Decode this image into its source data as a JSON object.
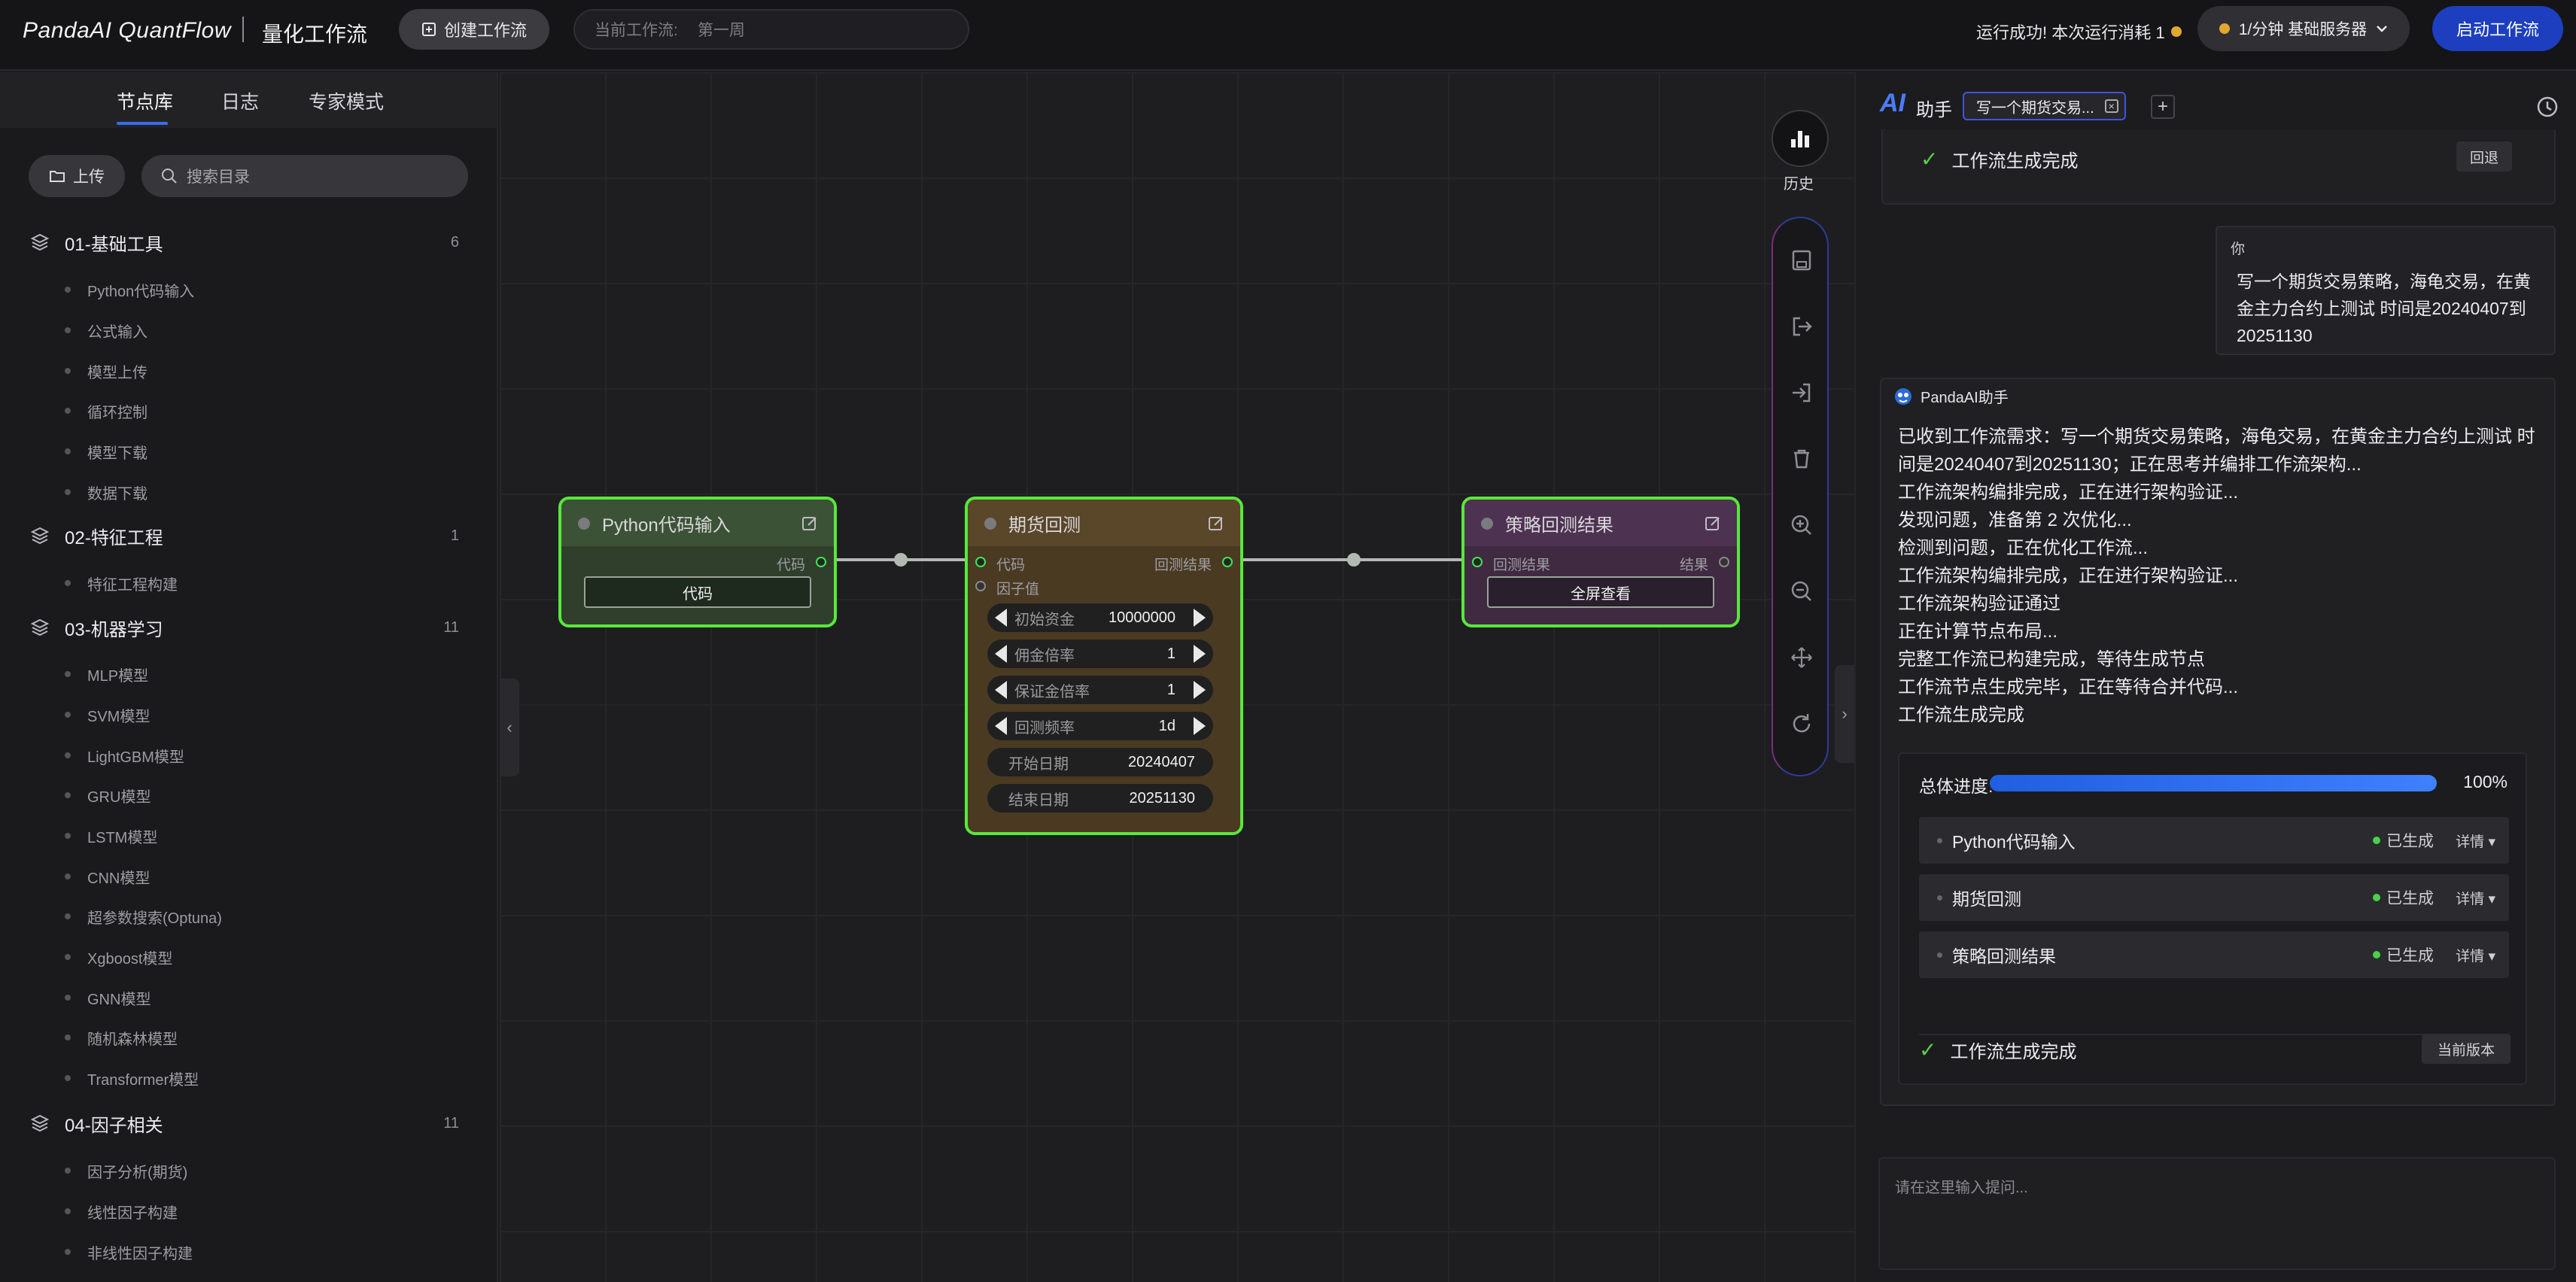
{
  "header": {
    "brand": "PandaAI QuantFlow",
    "subtitle": "量化工作流",
    "create_button": "创建工作流",
    "current_workflow_label": "当前工作流:",
    "current_workflow_value": "第一周",
    "run_status": "运行成功!  本次运行消耗 1",
    "server_label": "1/分钟   基础服务器",
    "launch_button": "启动工作流"
  },
  "sidebar": {
    "tabs": [
      "节点库",
      "日志",
      "专家模式"
    ],
    "upload_label": "上传",
    "search_placeholder": "搜索目录",
    "categories": [
      {
        "title": "01-基础工具",
        "count": "6",
        "items": [
          "Python代码输入",
          "公式输入",
          "模型上传",
          "循环控制",
          "模型下载",
          "数据下载"
        ]
      },
      {
        "title": "02-特征工程",
        "count": "1",
        "items": [
          "特征工程构建"
        ]
      },
      {
        "title": "03-机器学习",
        "count": "11",
        "items": [
          "MLP模型",
          "SVM模型",
          "LightGBM模型",
          "GRU模型",
          "LSTM模型",
          "CNN模型",
          "超参数搜索(Optuna)",
          "Xgboost模型",
          "GNN模型",
          "随机森林模型",
          "Transformer模型"
        ]
      },
      {
        "title": "04-因子相关",
        "count": "11",
        "items": [
          "因子分析(期货)",
          "线性因子构建",
          "非线性因子构建"
        ]
      }
    ]
  },
  "canvas": {
    "nodes": {
      "python": {
        "title": "Python代码输入",
        "out_port": "代码",
        "button": "代码"
      },
      "backtest": {
        "title": "期货回测",
        "in_ports": [
          "代码",
          "因子值"
        ],
        "out_port": "回测结果",
        "params": [
          {
            "label": "初始资金",
            "value": "10000000"
          },
          {
            "label": "佣金倍率",
            "value": "1"
          },
          {
            "label": "保证金倍率",
            "value": "1"
          },
          {
            "label": "回测频率",
            "value": "1d"
          },
          {
            "label": "开始日期",
            "value": "20240407"
          },
          {
            "label": "结束日期",
            "value": "20251130"
          }
        ]
      },
      "result": {
        "title": "策略回测结果",
        "in_port": "回测结果",
        "out_port": "结果",
        "button": "全屏查看"
      }
    },
    "history_label": "历史"
  },
  "ai": {
    "logo": "AI",
    "title": "助手",
    "tab_label": "写一个期货交易...",
    "top_status": "工作流生成完成",
    "rollback_button": "回退",
    "you_label": "你",
    "user_message": "写一个期货交易策略，海龟交易，在黄金主力合约上测试 时间是20240407到20251130",
    "assistant_name": "PandaAI助手",
    "assistant_lines": [
      "已收到工作流需求：写一个期货交易策略，海龟交易，在黄金主力合约上测试 时间是20240407到20251130；正在思考并编排工作流架构...",
      "工作流架构编排完成，正在进行架构验证...",
      "发现问题，准备第 2 次优化...",
      "检测到问题，正在优化工作流...",
      "工作流架构编排完成，正在进行架构验证...",
      "工作流架构验证通过",
      "正在计算节点布局...",
      "完整工作流已构建完成，等待生成节点",
      "工作流节点生成完毕，正在等待合并代码...",
      "工作流生成完成"
    ],
    "progress_label": "总体进度:",
    "progress_value": 1.0,
    "progress_text": "100%",
    "steps": [
      {
        "name": "Python代码输入",
        "status": "已生成",
        "detail": "详情 ▾"
      },
      {
        "name": "期货回测",
        "status": "已生成",
        "detail": "详情 ▾"
      },
      {
        "name": "策略回测结果",
        "status": "已生成",
        "detail": "详情 ▾"
      }
    ],
    "bottom_status": "工作流生成完成",
    "version_button": "当前版本",
    "input_placeholder": "请在这里输入提问..."
  }
}
